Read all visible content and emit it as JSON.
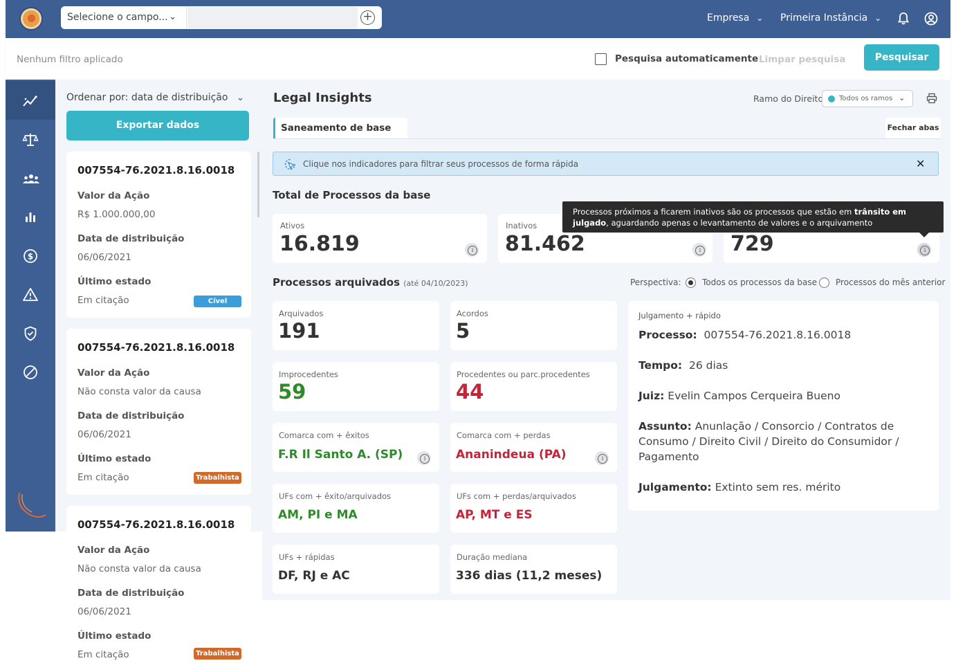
{
  "topbar": {
    "search_select_label": "Selecione o campo...",
    "search_placeholder": "",
    "company_menu": "Empresa",
    "instance_menu": "Primeira Instância"
  },
  "filterbar": {
    "no_filter": "Nenhum filtro aplicado",
    "auto_search_label": "Pesquisa automaticamente",
    "clear_label": "Limpar pesquisa",
    "search_button": "Pesquisar"
  },
  "sidebar": {
    "items": [
      "insights-icon",
      "scales-icon",
      "people-icon",
      "bar-chart-icon",
      "dollar-icon",
      "warning-icon",
      "shield-check-icon",
      "ban-icon"
    ]
  },
  "list": {
    "order_label": "Ordenar por: data de distribuição",
    "export_button": "Exportar dados",
    "cards": [
      {
        "number": "007554-76.2021.8.16.0018",
        "value_label": "Valor da Ação",
        "value": "R$ 1.000.000,00",
        "date_label": "Data de distribuição",
        "date": "06/06/2021",
        "state_label": "Último estado",
        "state": "Em citação",
        "badge": "Cível"
      },
      {
        "number": "007554-76.2021.8.16.0018",
        "value_label": "Valor da Ação",
        "value": "Não consta valor da causa",
        "date_label": "Data de distribuição",
        "date": "06/06/2021",
        "state_label": "Último estado",
        "state": "Em citação",
        "badge": "Trabalhista"
      },
      {
        "number": "007554-76.2021.8.16.0018",
        "value_label": "Valor da Ação",
        "value": "Não consta valor da causa",
        "date_label": "Data de distribuição",
        "date": "06/06/2021",
        "state_label": "Último estado",
        "state": "Em citação",
        "badge": "Trabalhista"
      }
    ]
  },
  "main": {
    "title": "Legal Insights",
    "ramo_label": "Ramo do Direito",
    "ramo_value": "Todos os ramos",
    "tab_label": "Saneamento de base",
    "close_tabs": "Fechar abas",
    "info_banner": "Clique nos indicadores para filtrar seus processos de forma rápida",
    "total_title": "Total de Processos da base",
    "kpis": [
      {
        "label": "Ativos",
        "value": "16.819"
      },
      {
        "label": "Inativos",
        "value": "81.462"
      },
      {
        "label": "",
        "value": "729"
      }
    ],
    "tooltip_part1": "Processos próximos a ficarem inativos são os processos que estão em ",
    "tooltip_bold": "trânsito em julgado",
    "tooltip_part2": ", aguardando apenas o levantamento de valores e o arquivamento",
    "archived_title": "Processos arquivados",
    "archived_note": "(até 04/10/2023)",
    "perspective_label": "Perspectiva:",
    "perspective_options": [
      "Todos os processos da base",
      "Processos do mês anterior"
    ],
    "boxes": [
      {
        "label": "Arquivados",
        "value": "191"
      },
      {
        "label": "Acordos",
        "value": "5"
      },
      {
        "label": "Improcedentes",
        "value": "59"
      },
      {
        "label": "Procedentes ou parc.procedentes",
        "value": "44"
      },
      {
        "label": "Comarca com + êxitos",
        "value": "F.R Il Santo A. (SP)"
      },
      {
        "label": "Comarca com + perdas",
        "value": "Ananindeua (PA)"
      },
      {
        "label": "UFs com + êxito/arquivados",
        "value": "AM, PI e MA"
      },
      {
        "label": "UFs com + perdas/arquivados",
        "value": "AP, MT e ES"
      },
      {
        "label": "UFs + rápidas",
        "value": "DF, RJ e AC"
      },
      {
        "label": "Duração mediana",
        "value": "336 dias (11,2 meses)"
      }
    ],
    "detail": {
      "header": "Julgamento + rápido",
      "process_label": "Processo:",
      "process_value": "007554-76.2021.8.16.0018",
      "time_label": "Tempo:",
      "time_value": "26 dias",
      "judge_label": "Juiz:",
      "judge_value": "Evelin Campos Cerqueira Bueno",
      "subject_label": "Assunto:",
      "subject_value": "Anunlação / Consorcio / Contratos de Consumo / Direito Civil / Direito do Consumidor / Pagamento",
      "judgment_label": "Julgamento:",
      "judgment_value": "Extinto sem res. mérito"
    }
  },
  "colors": {
    "primary": "#3d5f93",
    "accent": "#35b5c6",
    "positive": "#2f8a2a",
    "negative": "#c22438",
    "badge_civel": "#3a9ed9",
    "badge_trab": "#d06a2a"
  }
}
